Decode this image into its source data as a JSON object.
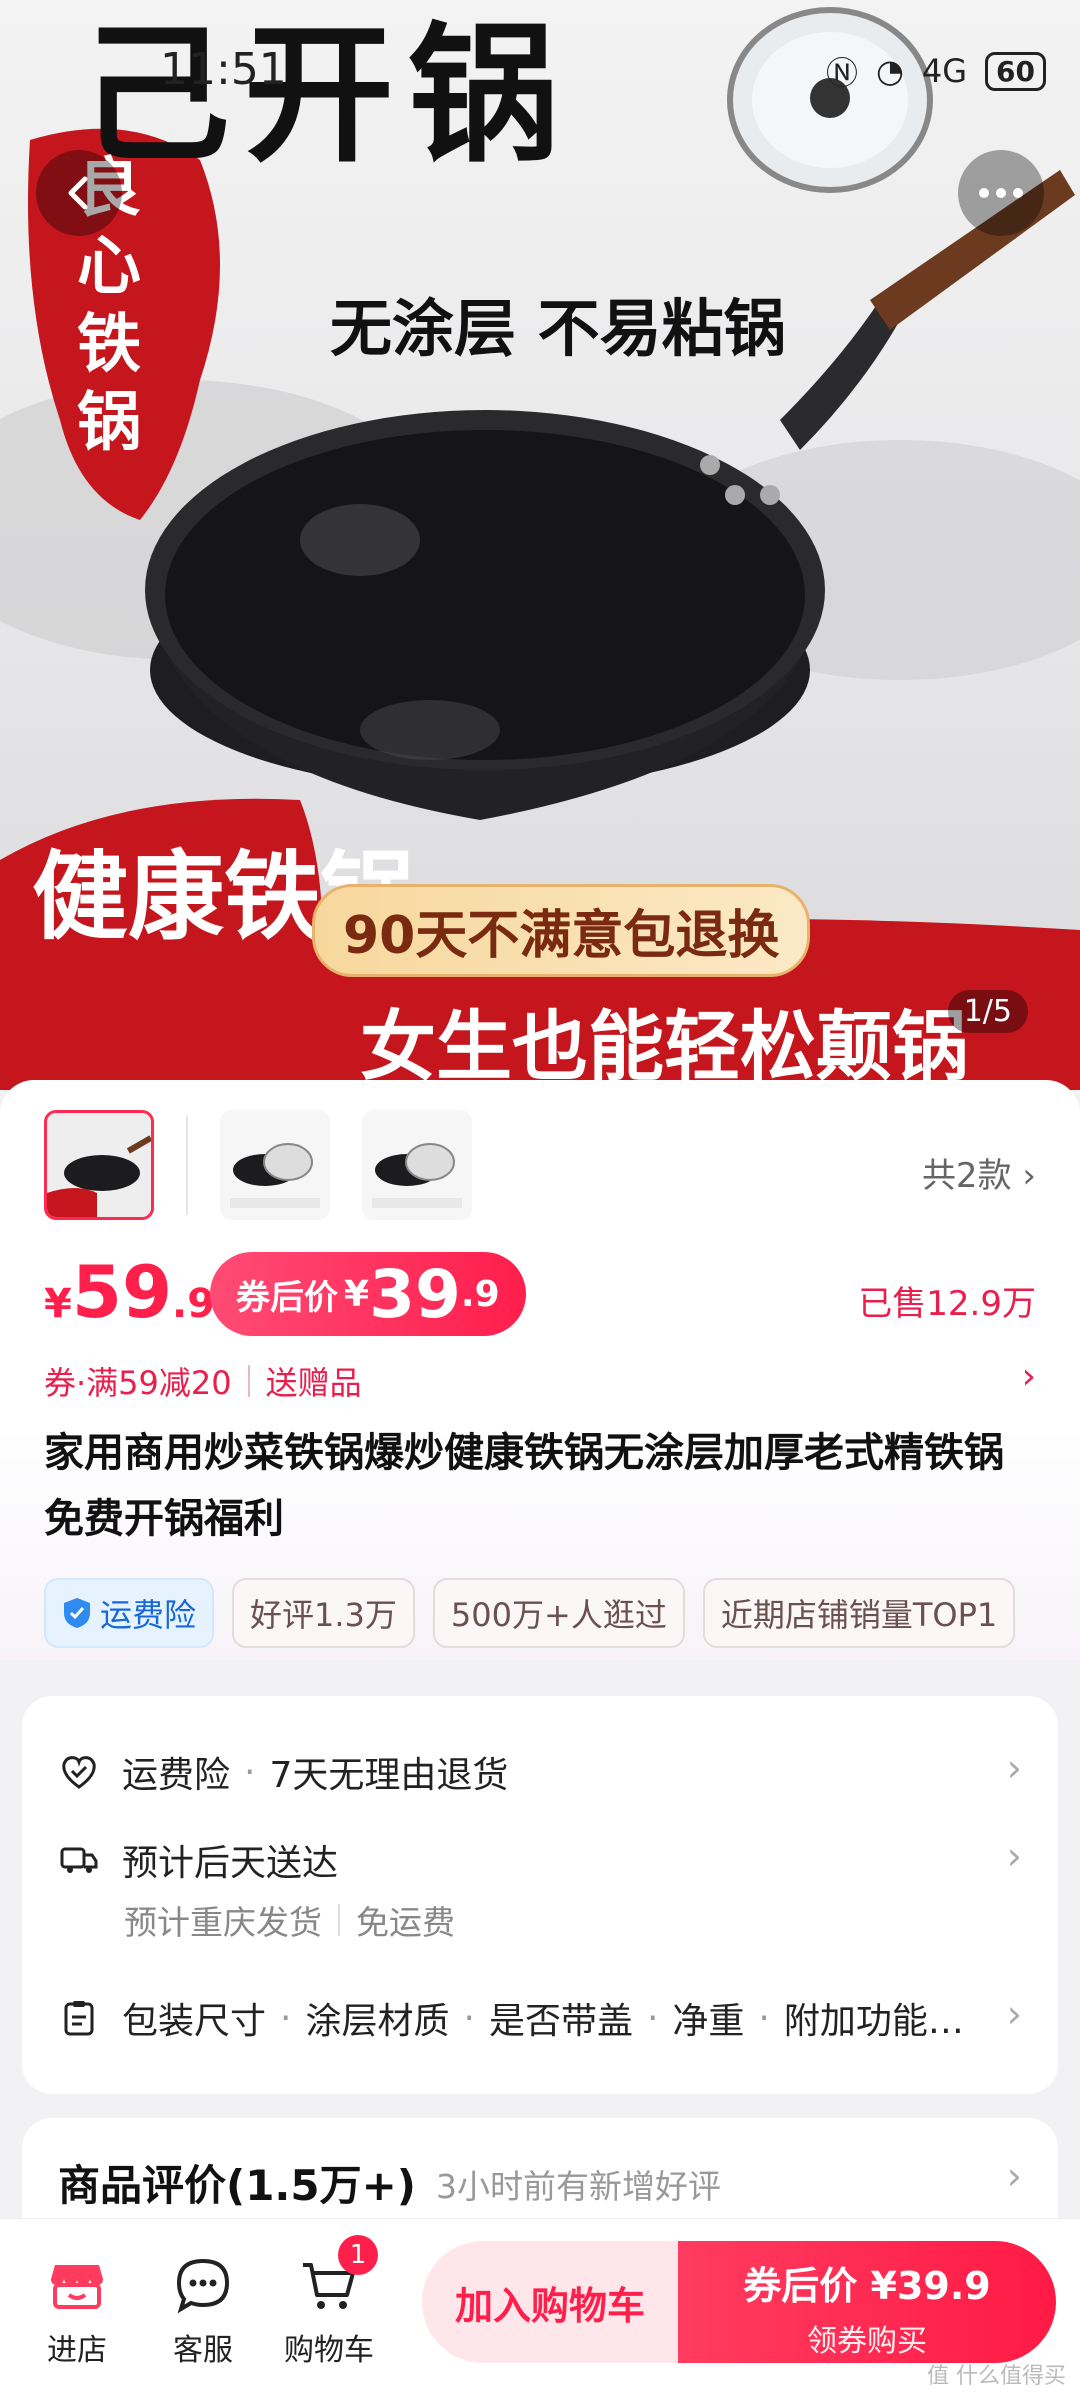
{
  "status_bar": {
    "time": "11:51",
    "network": "4G",
    "battery": "60"
  },
  "hero": {
    "title": "己开锅",
    "vertical_title": "良心铁锅",
    "tagline": "无涂层 不易粘锅",
    "promo": "90天不满意包退换",
    "health": "健康铁锅",
    "slogan": "女生也能轻松颠锅",
    "counter": "1/5"
  },
  "variants": {
    "count_label": "共2款"
  },
  "price": {
    "currency": "¥",
    "original_int": "59",
    "original_dec": ".9",
    "coupon_label": "券后价",
    "coupon_int": "39",
    "coupon_dec": ".9",
    "sold": "已售12.9万"
  },
  "promotions": {
    "coupon": "券·满59减20",
    "gift": "送赠品"
  },
  "product_title": "家用商用炒菜铁锅爆炒健康铁锅无涂层加厚老式精铁锅免费开锅福利",
  "tags": [
    "运费险",
    "好评1.3万",
    "500万+人逛过",
    "近期店铺销量TOP1"
  ],
  "services": {
    "insurance": "运费险",
    "return_policy": "7天无理由退货",
    "delivery": "预计后天送达",
    "ship_from": "预计重庆发货",
    "shipping_fee": "免运费",
    "specs": [
      "包装尺寸",
      "涂层材质",
      "是否带盖",
      "净重",
      "附加功能…"
    ]
  },
  "reviews": {
    "title": "商品评价(1.5万+)",
    "subtitle": "3小时前有新增好评"
  },
  "bottom_bar": {
    "store": "进店",
    "service": "客服",
    "cart": "购物车",
    "cart_badge": "1",
    "add_to_cart": "加入购物车",
    "buy_line1": "券后价 ¥39.9",
    "buy_line2": "领券购买"
  },
  "watermark": "值 什么值得买",
  "colors": {
    "accent": "#ff1f4b",
    "insurance_blue": "#1768d8",
    "hero_red": "#c4161c"
  }
}
